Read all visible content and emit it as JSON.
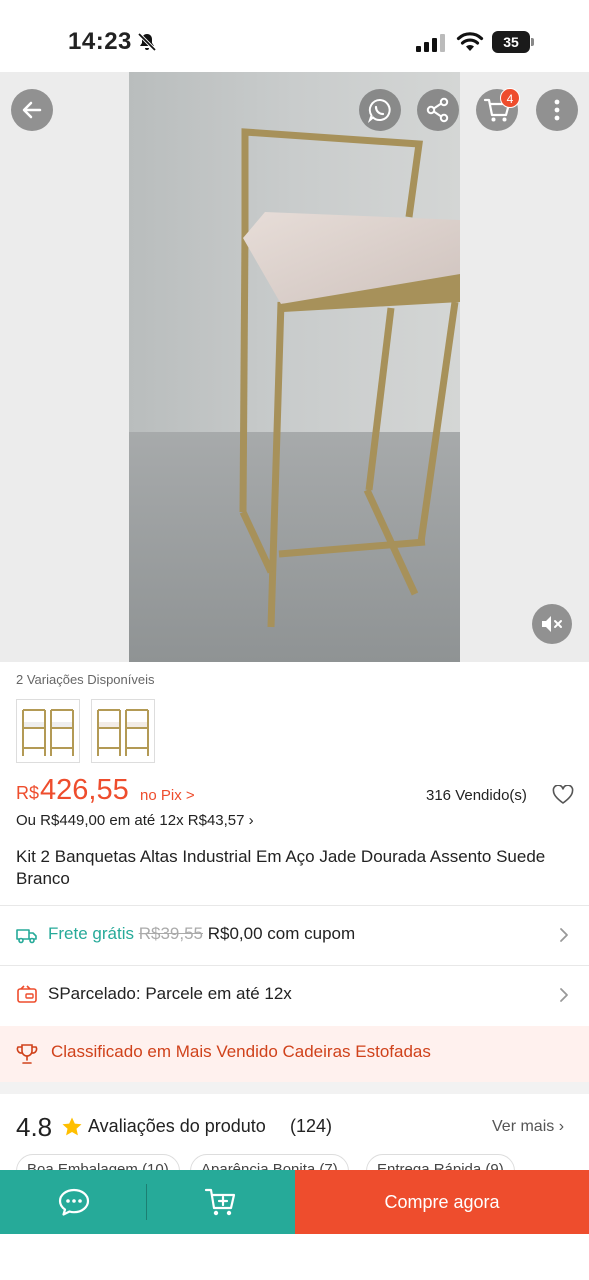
{
  "status_bar": {
    "time": "14:23",
    "battery": "35"
  },
  "hero": {
    "cart_count": "4"
  },
  "product": {
    "variations_label": "2 Variações Disponíveis",
    "currency": "R$",
    "price": "426,55",
    "pix_label": "no Pix >",
    "sold": "316 Vendido(s)",
    "installments": "Ou R$449,00 em até 12x R$43,57 ›",
    "title": "Kit 2 Banquetas Altas Industrial Em Aço Jade Dourada Assento Suede Branco"
  },
  "shipping": {
    "label": "Frete grátis",
    "old_price": "R$39,55",
    "new_price": "R$0,00 com cupom"
  },
  "parcelado": {
    "label": "SParcelado: Parcele em até 12x"
  },
  "ranking": {
    "label": "Classificado em Mais Vendido Cadeiras Estofadas"
  },
  "reviews": {
    "score": "4.8",
    "label": "Avaliações do produto",
    "count": "(124)",
    "see_more": "Ver mais",
    "chips": [
      "Boa Embalagem (10)",
      "Aparência Bonita (7)",
      "Entrega Rápida (9)"
    ]
  },
  "bottom_bar": {
    "buy_label": "Compre agora"
  },
  "colors": {
    "accent": "#ee4d2d",
    "teal": "#26aa99"
  }
}
